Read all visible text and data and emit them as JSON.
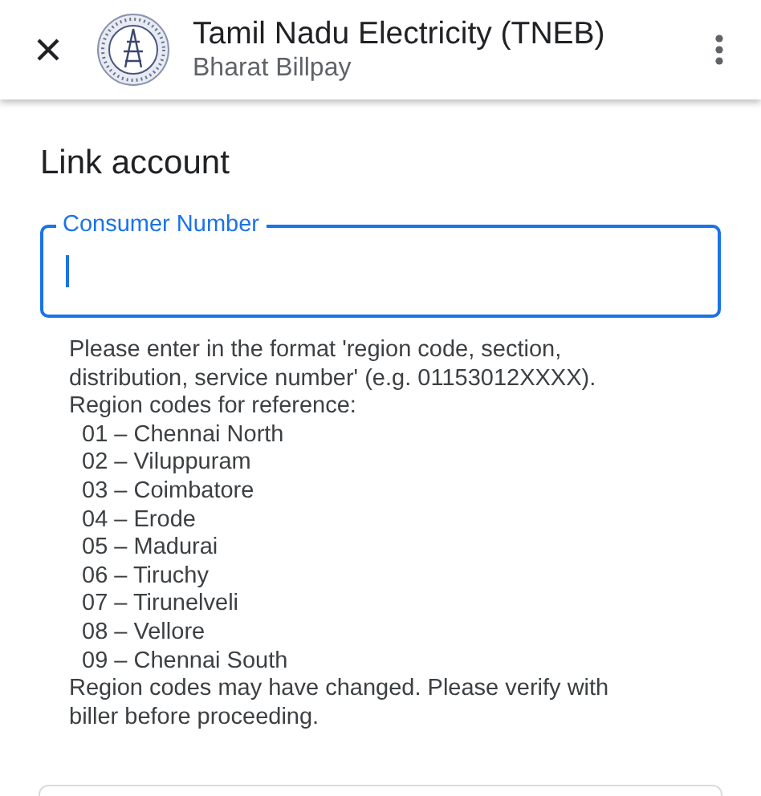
{
  "app_bar": {
    "title": "Tamil Nadu Electricity (TNEB)",
    "subtitle": "Bharat Billpay"
  },
  "heading": "Link account",
  "field": {
    "label": "Consumer Number",
    "focused": true
  },
  "helper_lines": [
    {
      "kind": "text",
      "text": "Please enter in the format 'region code, section,"
    },
    {
      "kind": "text",
      "text": "distribution, service number' (e.g. 01153012XXXX)."
    },
    {
      "kind": "text",
      "text": "Region codes for reference:"
    },
    {
      "kind": "region",
      "text": "01 – Chennai North"
    },
    {
      "kind": "region",
      "text": "02 – Viluppuram"
    },
    {
      "kind": "region",
      "text": "03 – Coimbatore"
    },
    {
      "kind": "region",
      "text": "04 – Erode"
    },
    {
      "kind": "region",
      "text": "05 – Madurai"
    },
    {
      "kind": "region",
      "text": "06 – Tiruchy"
    },
    {
      "kind": "region",
      "text": "07 – Tirunelveli"
    },
    {
      "kind": "region",
      "text": "08 – Vellore"
    },
    {
      "kind": "region",
      "text": "09 – Chennai South"
    },
    {
      "kind": "text",
      "text": "Region codes may have changed. Please verify with"
    },
    {
      "kind": "text",
      "text": "biller before proceeding."
    }
  ]
}
